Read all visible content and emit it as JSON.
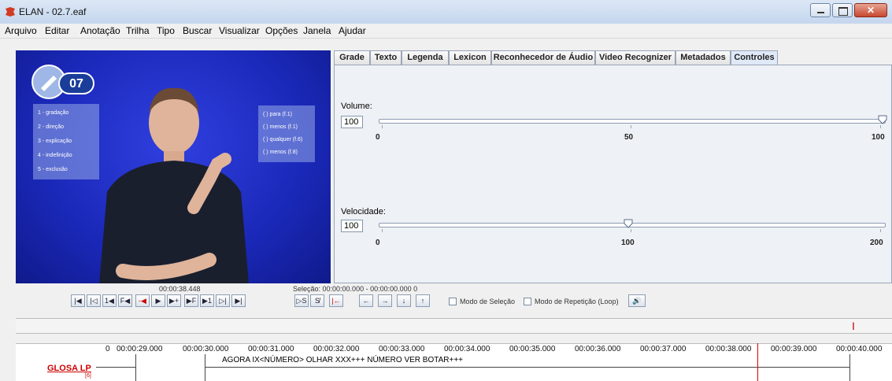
{
  "window": {
    "title": "ELAN - 02.7.eaf"
  },
  "menu": [
    "Arquivo",
    "Editar",
    "Anotação",
    "Trilha",
    "Tipo",
    "Buscar",
    "Visualizar",
    "Opções",
    "Janela",
    "Ajudar"
  ],
  "video": {
    "badge_number": "07",
    "options": [
      "1 - gradação",
      "2 - direção",
      "3 - explicação",
      "4 - indefinição",
      "5 - exclusão"
    ],
    "words": [
      "(  ) para (f.1)",
      "(  ) menos (f.1)",
      "(  ) qualquer (f.6)",
      "(  ) menos (f.8)"
    ]
  },
  "tabs": [
    "Grade",
    "Texto",
    "Legenda",
    "Lexicon",
    "Reconhecedor de Áudio",
    "Video Recognizer",
    "Metadados",
    "Controles"
  ],
  "active_tab": "Controles",
  "controls_panel": {
    "volume_label": "Volume:",
    "volume_value": "100",
    "volume_ticks": [
      "0",
      "50",
      "100"
    ],
    "speed_label": "Velocidade:",
    "speed_value": "100",
    "speed_ticks": [
      "0",
      "100",
      "200"
    ]
  },
  "player": {
    "current_time": "00:00:38.448",
    "selection": "Seleção: 00:00:00.000 - 00:00:00.000  0",
    "selection_mode": "Modo de Seleção",
    "loop_mode": "Modo de Repetição (Loop)"
  },
  "ruler": {
    "start": "0",
    "labels": [
      "00:00:29.000",
      "00:00:30.000",
      "00:00:31.000",
      "00:00:32.000",
      "00:00:33.000",
      "00:00:34.000",
      "00:00:35.000",
      "00:00:36.000",
      "00:00:37.000",
      "00:00:38.000",
      "00:00:39.000",
      "00:00:40.000"
    ]
  },
  "tier": {
    "name": "GLOSA LP",
    "count": "[6]",
    "annotation": "AGORA IX<NÚMERO> OLHAR XXX+++ NÚMERO VER BOTAR+++"
  }
}
